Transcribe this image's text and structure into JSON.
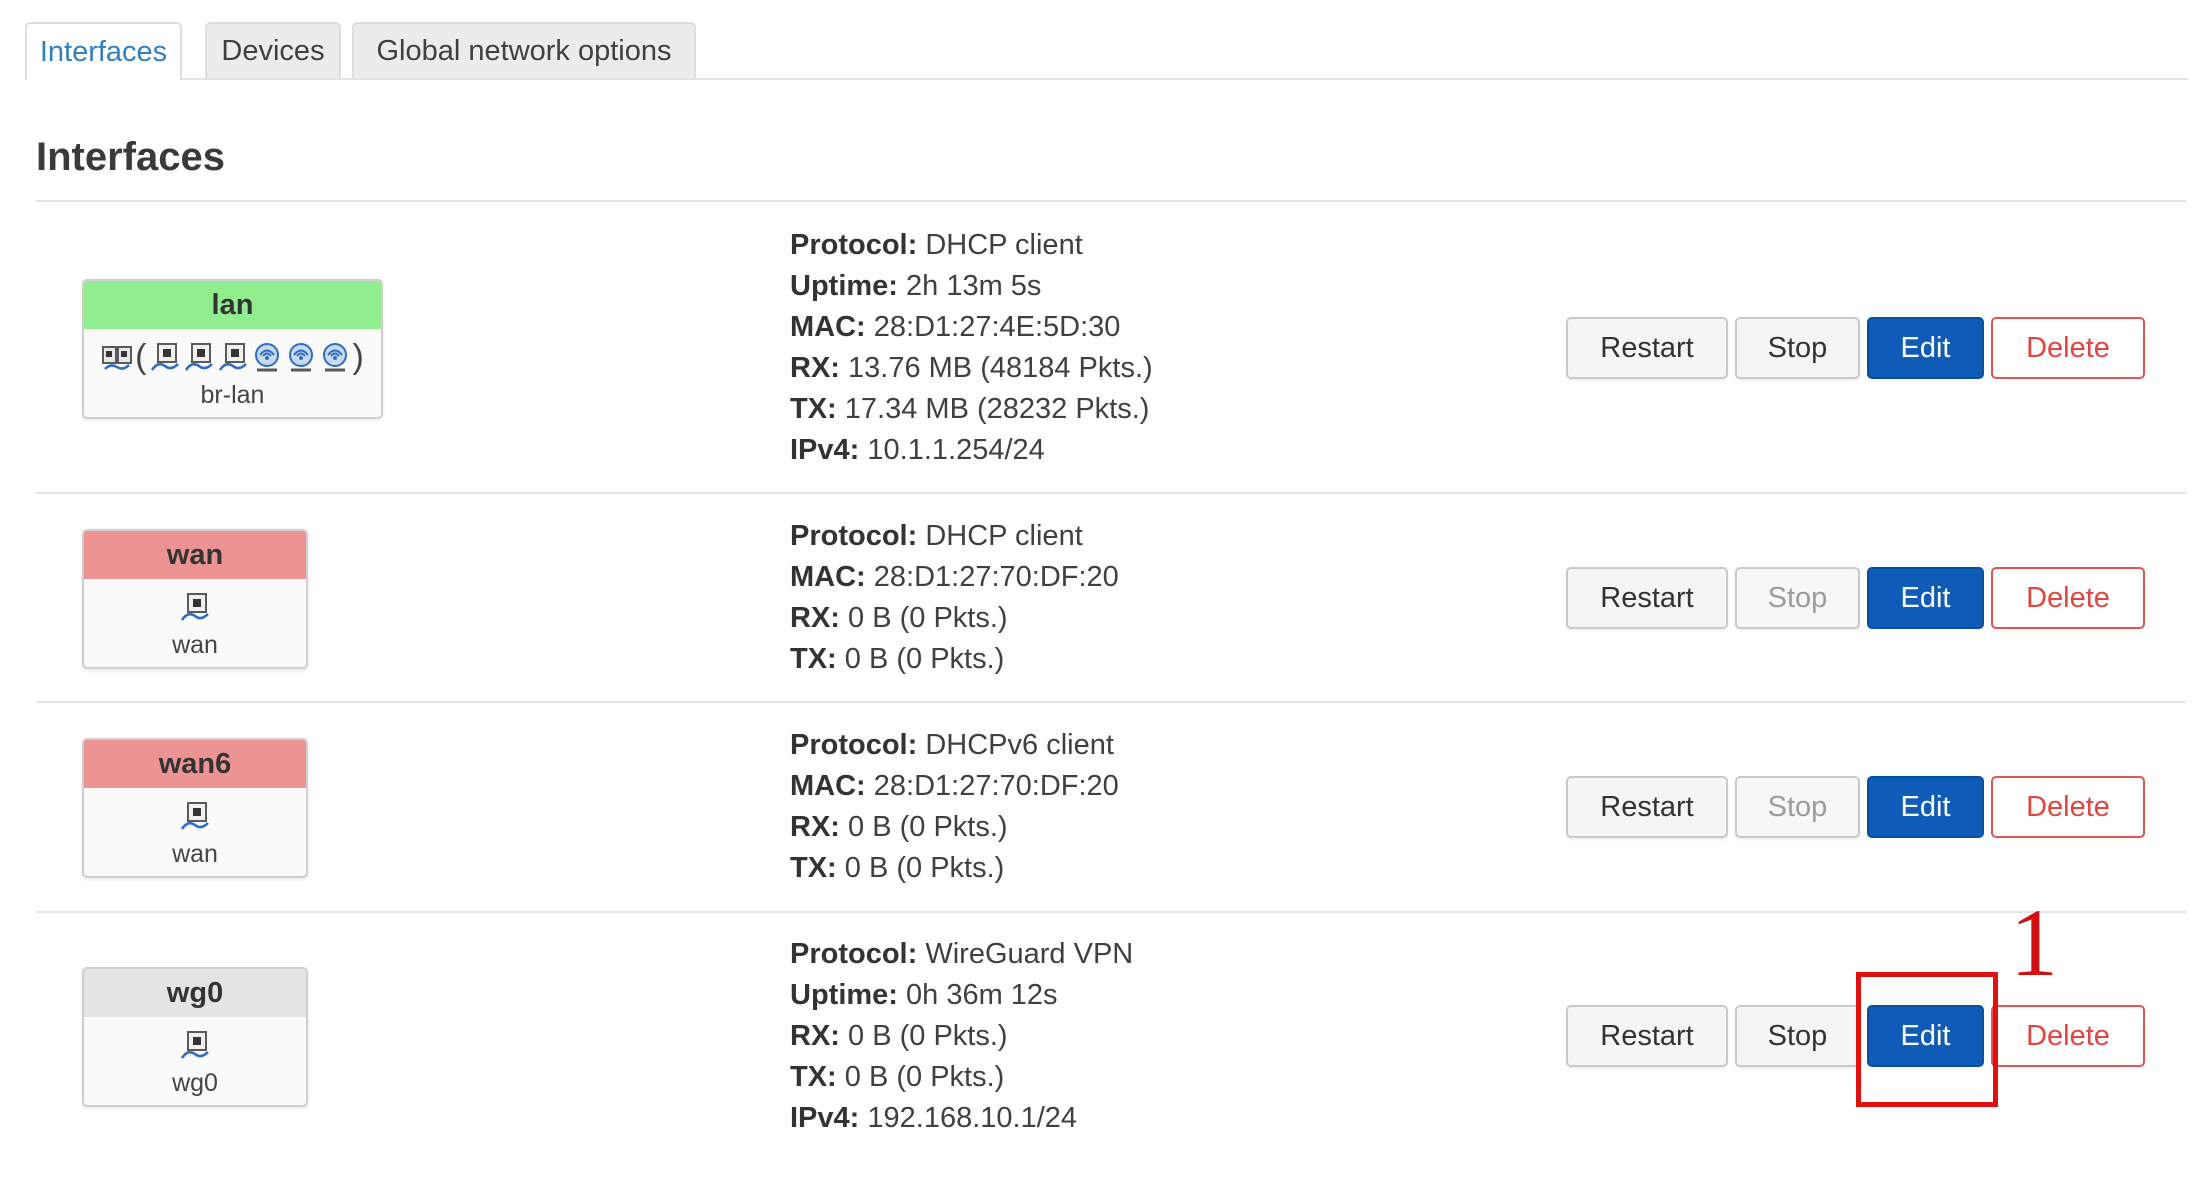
{
  "tabs": [
    {
      "label": "Interfaces",
      "active": true
    },
    {
      "label": "Devices",
      "active": false
    },
    {
      "label": "Global network options",
      "active": false
    }
  ],
  "section_title": "Interfaces",
  "colors": {
    "lan_header": "#90ee8f",
    "wan_header": "#ee9394",
    "wan6_header": "#ee9394",
    "wg0_header": "#e4e4e4",
    "edit_button": "#0f5cb8",
    "delete_text": "#e0453e",
    "active_tab": "#2f7fc2",
    "annotation": "#e01010"
  },
  "interfaces": [
    {
      "name": "lan",
      "device": "br-lan",
      "icons": [
        "bridge-icon",
        "ethernet-port-icon",
        "ethernet-port-icon",
        "ethernet-port-icon",
        "wifi-icon",
        "wifi-icon",
        "wifi-icon"
      ],
      "info": [
        {
          "key": "Protocol:",
          "value": "DHCP client"
        },
        {
          "key": "Uptime:",
          "value": "2h 13m 5s"
        },
        {
          "key": "MAC:",
          "value": "28:D1:27:4E:5D:30"
        },
        {
          "key": "RX:",
          "value": "13.76 MB (48184 Pkts.)"
        },
        {
          "key": "TX:",
          "value": "17.34 MB (28232 Pkts.)"
        },
        {
          "key": "IPv4:",
          "value": "10.1.1.254/24"
        }
      ],
      "stop_disabled": false
    },
    {
      "name": "wan",
      "device": "wan",
      "icons": [
        "ethernet-port-icon"
      ],
      "info": [
        {
          "key": "Protocol:",
          "value": "DHCP client"
        },
        {
          "key": "MAC:",
          "value": "28:D1:27:70:DF:20"
        },
        {
          "key": "RX:",
          "value": "0 B (0 Pkts.)"
        },
        {
          "key": "TX:",
          "value": "0 B (0 Pkts.)"
        }
      ],
      "stop_disabled": true
    },
    {
      "name": "wan6",
      "device": "wan",
      "icons": [
        "ethernet-port-icon"
      ],
      "info": [
        {
          "key": "Protocol:",
          "value": "DHCPv6 client"
        },
        {
          "key": "MAC:",
          "value": "28:D1:27:70:DF:20"
        },
        {
          "key": "RX:",
          "value": "0 B (0 Pkts.)"
        },
        {
          "key": "TX:",
          "value": "0 B (0 Pkts.)"
        }
      ],
      "stop_disabled": true
    },
    {
      "name": "wg0",
      "device": "wg0",
      "icons": [
        "ethernet-port-icon"
      ],
      "info": [
        {
          "key": "Protocol:",
          "value": "WireGuard VPN"
        },
        {
          "key": "Uptime:",
          "value": "0h 36m 12s"
        },
        {
          "key": "RX:",
          "value": "0 B (0 Pkts.)"
        },
        {
          "key": "TX:",
          "value": "0 B (0 Pkts.)"
        },
        {
          "key": "IPv4:",
          "value": "192.168.10.1/24"
        }
      ],
      "stop_disabled": false
    }
  ],
  "buttons": {
    "restart": "Restart",
    "stop": "Stop",
    "edit": "Edit",
    "delete": "Delete"
  },
  "annotation": {
    "label": "1"
  }
}
